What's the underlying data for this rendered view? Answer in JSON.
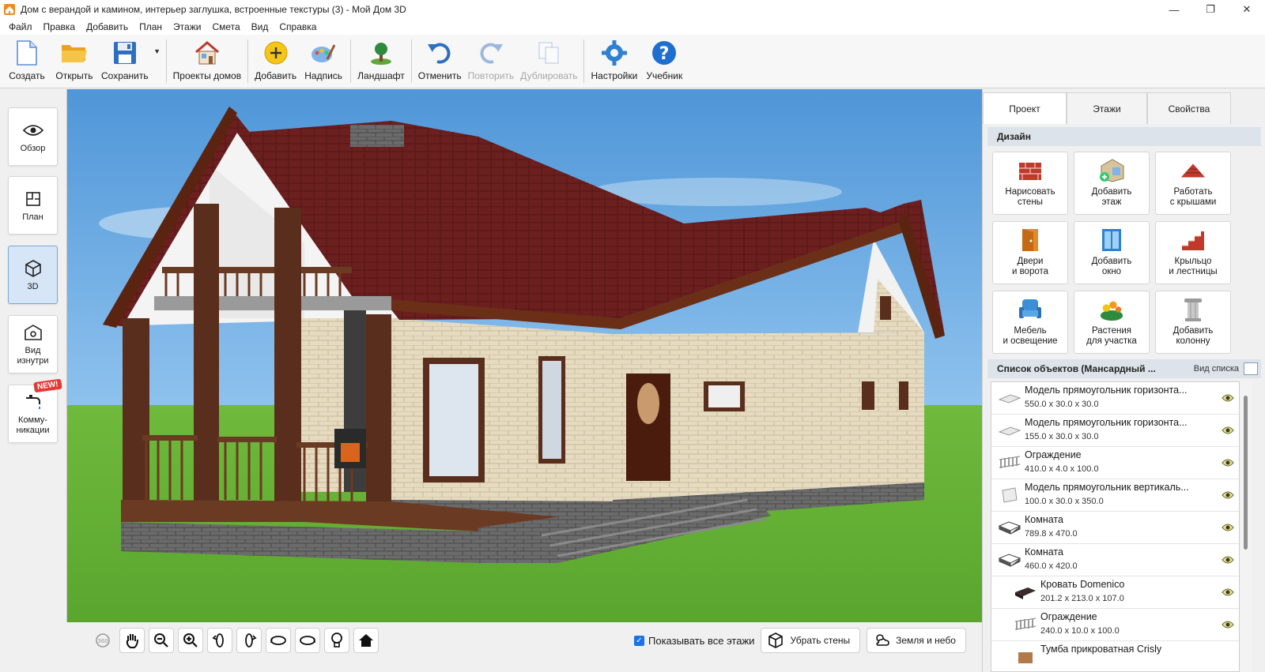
{
  "window": {
    "title": "Дом с верандой и камином, интерьер заглушка, встроенные текстуры (3) - Мой Дом 3D",
    "minimize": "—",
    "maximize": "❐",
    "close": "✕"
  },
  "menu": [
    "Файл",
    "Правка",
    "Добавить",
    "План",
    "Этажи",
    "Смета",
    "Вид",
    "Справка"
  ],
  "toolbar": {
    "create": "Создать",
    "open": "Открыть",
    "save": "Сохранить",
    "projects": "Проекты домов",
    "add": "Добавить",
    "label": "Надпись",
    "landscape": "Ландшафт",
    "undo": "Отменить",
    "redo": "Повторить",
    "duplicate": "Дублировать",
    "settings": "Настройки",
    "tutorial": "Учебник"
  },
  "left_panel": {
    "overview": "Обзор",
    "plan": "План",
    "view3d": "3D",
    "inside": "Вид изнутри",
    "communications": "Комму-никации",
    "new_badge": "NEW!"
  },
  "bottom_bar": {
    "show_all_floors": "Показывать все этажи",
    "show_all_floors_checked": true,
    "remove_walls": "Убрать стены",
    "ground_sky": "Земля и небо"
  },
  "right_panel": {
    "tabs": [
      "Проект",
      "Этажи",
      "Свойства"
    ],
    "active_tab": "Проект",
    "design_header": "Дизайн",
    "design_items": [
      {
        "line1": "Нарисовать",
        "line2": "стены"
      },
      {
        "line1": "Добавить",
        "line2": "этаж"
      },
      {
        "line1": "Работать",
        "line2": "с крышами"
      },
      {
        "line1": "Двери",
        "line2": "и ворота"
      },
      {
        "line1": "Добавить",
        "line2": "окно"
      },
      {
        "line1": "Крыльцо",
        "line2": "и лестницы"
      },
      {
        "line1": "Мебель",
        "line2": "и освещение"
      },
      {
        "line1": "Растения",
        "line2": "для участка"
      },
      {
        "line1": "Добавить",
        "line2": "колонну"
      }
    ],
    "objects_header": "Список объектов (Мансардный ...",
    "view_list": "Вид списка",
    "objects": [
      {
        "name": "Модель прямоугольник горизонта...",
        "size": "550.0 x 30.0 x 30.0",
        "indent": 0,
        "icon": "slab-icon"
      },
      {
        "name": "Модель прямоугольник горизонта...",
        "size": "155.0 x 30.0 x 30.0",
        "indent": 0,
        "icon": "slab-icon"
      },
      {
        "name": "Ограждение",
        "size": "410.0 x 4.0 x 100.0",
        "indent": 0,
        "icon": "fence-icon"
      },
      {
        "name": "Модель прямоугольник вертикаль...",
        "size": "100.0 x 30.0 x 350.0",
        "indent": 0,
        "icon": "panel-icon"
      },
      {
        "name": "Комната",
        "size": "789.8 x 470.0",
        "indent": 0,
        "icon": "room-icon"
      },
      {
        "name": "Комната",
        "size": "460.0 x 420.0",
        "indent": 0,
        "icon": "room-icon"
      },
      {
        "name": "Кровать Domenico",
        "size": "201.2 x 213.0 x 107.0",
        "indent": 1,
        "icon": "bed-icon"
      },
      {
        "name": "Ограждение",
        "size": "240.0 x 10.0 x 100.0",
        "indent": 1,
        "icon": "fence-icon"
      },
      {
        "name": "Тумба прикроватная Crisly",
        "size": "",
        "indent": 1,
        "icon": "nightstand-icon"
      }
    ]
  },
  "colors": {
    "sky": "#5ea3e0",
    "grass": "#6cb83a",
    "roof": "#6a1e1e",
    "brick": "#e8dcc2",
    "wood": "#5a2e1c",
    "accent": "#1a73e8"
  }
}
